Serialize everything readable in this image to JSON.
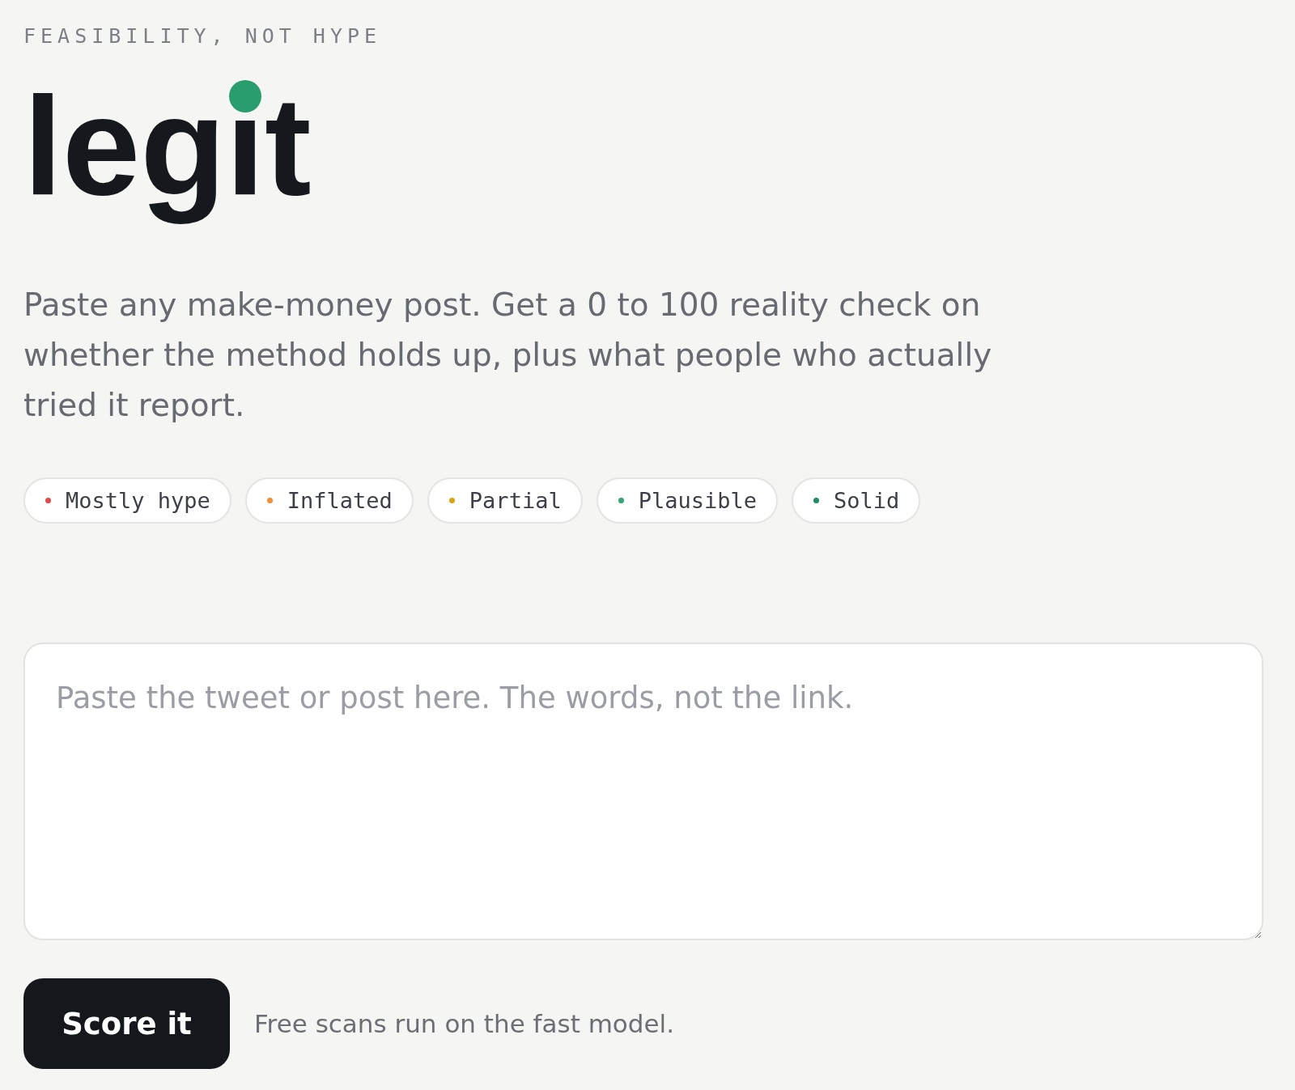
{
  "eyebrow": "FEASIBILITY, NOT HYPE",
  "logo": {
    "text": "legit"
  },
  "intro": "Paste any make-money post. Get a 0 to 100 reality check on whether the method holds up, plus what people who actually tried it report.",
  "verdict_scale": [
    {
      "label": "Mostly hype",
      "color": "#e0484a"
    },
    {
      "label": "Inflated",
      "color": "#ef8f3a"
    },
    {
      "label": "Partial",
      "color": "#d6a415"
    },
    {
      "label": "Plausible",
      "color": "#34a576"
    },
    {
      "label": "Solid",
      "color": "#1f8f62"
    }
  ],
  "post_input": {
    "placeholder": "Paste the tweet or post here. The words, not the link."
  },
  "submit_button": {
    "label": "Score it"
  },
  "note": "Free scans run on the fast model."
}
